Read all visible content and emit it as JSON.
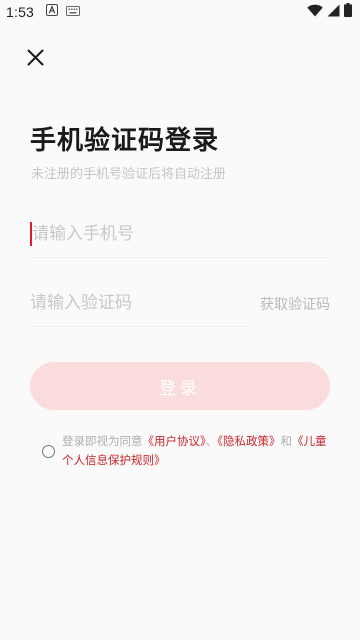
{
  "status_bar": {
    "time": "1:53",
    "left_icons": [
      "a-badge-icon",
      "keyboard-icon"
    ],
    "right_icons": [
      "wifi-icon",
      "cell-signal-icon",
      "battery-icon"
    ]
  },
  "header": {
    "close_icon": "close-icon"
  },
  "main": {
    "title": "手机验证码登录",
    "subtitle": "未注册的手机号验证后将自动注册",
    "phone_placeholder": "请输入手机号",
    "code_placeholder": "请输入验证码",
    "get_code_label": "获取验证码",
    "login_label": "登录"
  },
  "agreement": {
    "prefix": "登录即视为同意",
    "user_agreement": "《用户协议》",
    "separator": "、",
    "privacy_policy": "《隐私政策》",
    "and": "和",
    "child_rules": "《儿童个人信息保护规则》"
  },
  "colors": {
    "accent": "#c8262d",
    "button_disabled_bg": "#fbdcdc",
    "placeholder": "#c8c8c8",
    "background": "#fafafa"
  }
}
